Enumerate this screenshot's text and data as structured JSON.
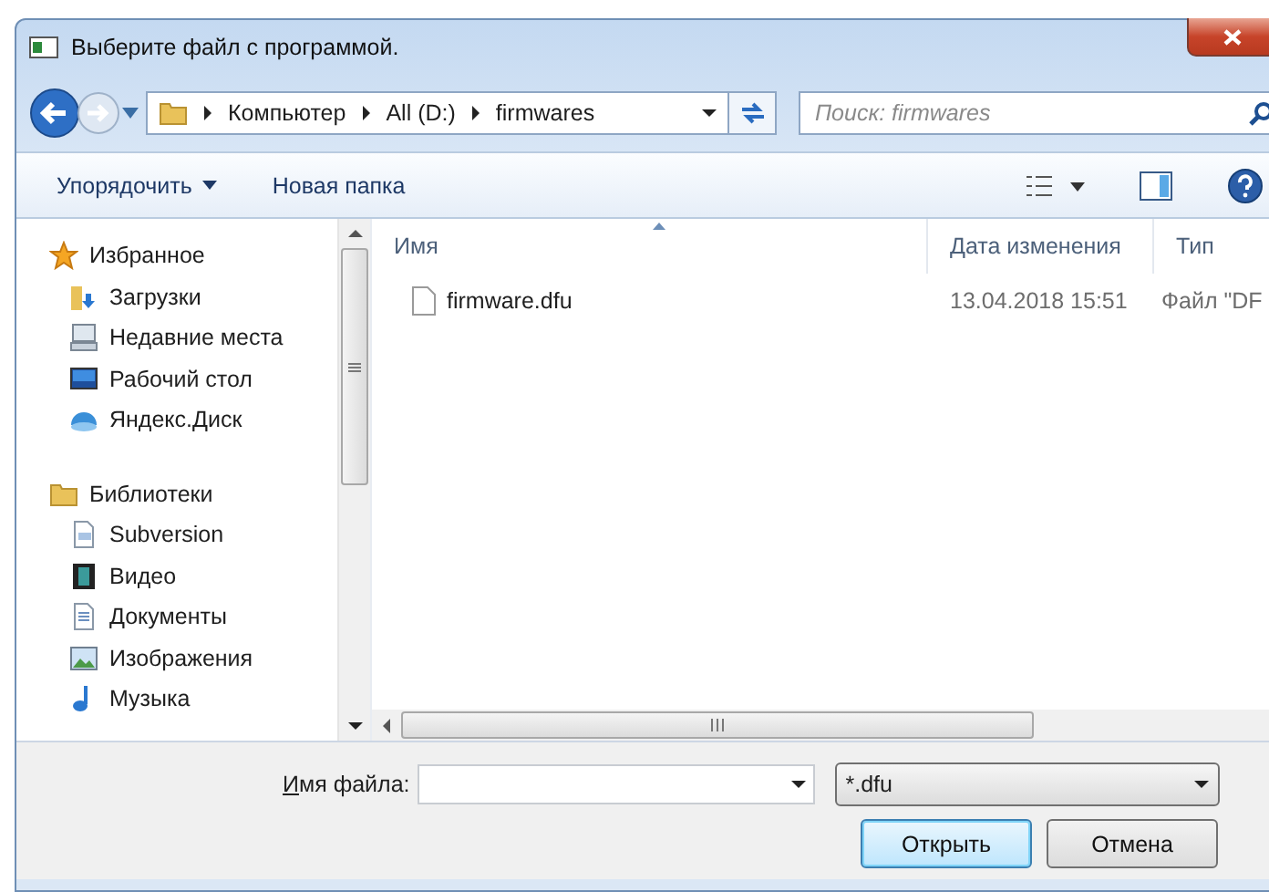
{
  "window": {
    "title": "Выберите файл с программой."
  },
  "address": {
    "path": [
      "Компьютер",
      "All (D:)",
      "firmwares"
    ],
    "search_placeholder": "Поиск: firmwares"
  },
  "toolbar": {
    "organize": "Упорядочить",
    "new_folder": "Новая папка"
  },
  "sidebar": {
    "groups": [
      {
        "label": "Избранное",
        "children": [
          {
            "label": "Загрузки"
          },
          {
            "label": "Недавние места"
          },
          {
            "label": "Рабочий стол"
          },
          {
            "label": "Яндекс.Диск"
          }
        ]
      },
      {
        "label": "Библиотеки",
        "children": [
          {
            "label": "Subversion"
          },
          {
            "label": "Видео"
          },
          {
            "label": "Документы"
          },
          {
            "label": "Изображения"
          },
          {
            "label": "Музыка"
          }
        ]
      }
    ]
  },
  "table": {
    "columns": [
      "Имя",
      "Дата изменения",
      "Тип"
    ],
    "rows": [
      {
        "name": "firmware.dfu",
        "date": "13.04.2018 15:51",
        "type": "Файл \"DF"
      }
    ]
  },
  "footer": {
    "filename_label": "Имя файла:",
    "filter": "*.dfu",
    "buttons": [
      {
        "label": "Открыть",
        "default": true
      },
      {
        "label": "Отмена",
        "default": false
      }
    ]
  }
}
